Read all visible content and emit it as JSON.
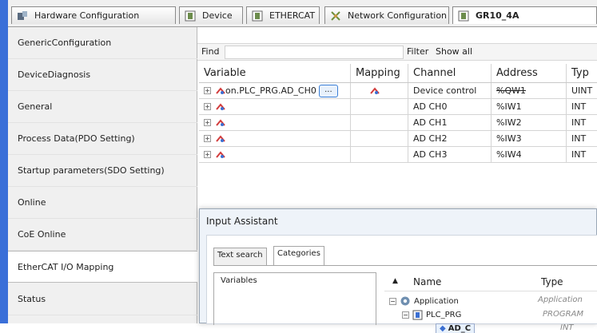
{
  "tabs": [
    {
      "label": "Hardware Configuration",
      "icon": "hardware-icon"
    },
    {
      "label": "Device",
      "icon": "device-icon"
    },
    {
      "label": "ETHERCAT",
      "icon": "device-icon"
    },
    {
      "label": "Network Configuration",
      "icon": "network-icon"
    },
    {
      "label": "GR10_4A",
      "icon": "device-icon"
    }
  ],
  "sidebar": {
    "items": [
      {
        "label": "GenericConfiguration"
      },
      {
        "label": "DeviceDiagnosis"
      },
      {
        "label": "General"
      },
      {
        "label": "Process Data(PDO Setting)"
      },
      {
        "label": "Startup parameters(SDO Setting)"
      },
      {
        "label": "Online"
      },
      {
        "label": "CoE Online"
      },
      {
        "label": "EtherCAT I/O Mapping"
      },
      {
        "label": "Status"
      }
    ],
    "active": "EtherCAT I/O Mapping"
  },
  "find": {
    "label": "Find",
    "filter_label": "Filter",
    "filter_value": "Show all"
  },
  "table": {
    "headers": [
      "Variable",
      "Mapping",
      "Channel",
      "Address",
      "Typ"
    ],
    "rows": [
      {
        "variable": "on.PLC_PRG.AD_CH0",
        "channel": "Device control",
        "address": "%QW1",
        "type": "UINT"
      },
      {
        "variable": "",
        "channel": "AD CH0",
        "address": "%IW1",
        "type": "INT"
      },
      {
        "variable": "",
        "channel": "AD CH1",
        "address": "%IW2",
        "type": "INT"
      },
      {
        "variable": "",
        "channel": "AD CH2",
        "address": "%IW3",
        "type": "INT"
      },
      {
        "variable": "",
        "channel": "AD CH3",
        "address": "%IW4",
        "type": "INT"
      }
    ],
    "dots_label": "..."
  },
  "dialog": {
    "title": "Input Assistant",
    "tabs": [
      "Text search",
      "Categories"
    ],
    "active_tab": "Categories",
    "categories": [
      "Variables"
    ],
    "tree": {
      "headers": [
        "Name",
        "Type"
      ],
      "rows": [
        {
          "name": "Application",
          "type": "Application"
        },
        {
          "name": "PLC_PRG",
          "type": "PROGRAM"
        },
        {
          "name": "AD_C",
          "type": "INT"
        }
      ]
    }
  },
  "colors": {
    "accent": "#3a6fd8",
    "mapping_icon": "#d23b3b"
  }
}
